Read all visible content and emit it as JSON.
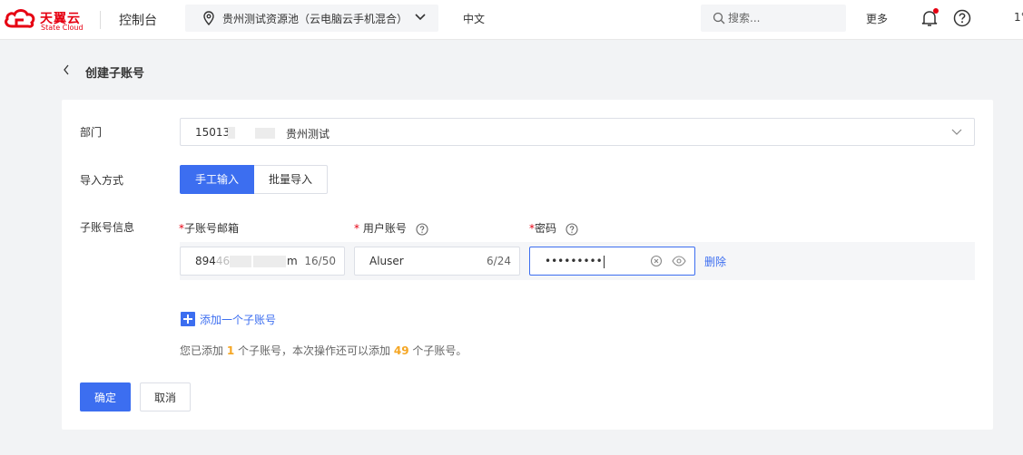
{
  "header": {
    "logo_cn": "天翼云",
    "logo_en": "State Cloud",
    "console": "控制台",
    "region": "贵州测试资源池（云电脑云手机混合）",
    "language": "中文",
    "search_placeholder": "搜索...",
    "more": "更多",
    "user": "1°"
  },
  "page": {
    "title": "创建子账号"
  },
  "form": {
    "department": {
      "label": "部门",
      "value_id": "15013",
      "value_name": "贵州测试"
    },
    "import_mode": {
      "label": "导入方式",
      "options": [
        "手工输入",
        "批量导入"
      ],
      "selected": "手工输入"
    },
    "subaccount": {
      "label": "子账号信息",
      "columns": {
        "email": "子账号邮箱",
        "username": "用户账号",
        "password": "密码"
      },
      "rows": [
        {
          "email_start": "894",
          "email_partial": "46",
          "email_end": "m",
          "email_count": "16/50",
          "username": "Aluser",
          "username_count": "6/24",
          "password_mask": "•••••••••",
          "delete": "删除"
        }
      ]
    },
    "add_button": "添加一个子账号",
    "info": {
      "prefix": "您已添加",
      "added": "1",
      "middle": "个子账号，本次操作还可以添加",
      "remaining": "49",
      "suffix": "个子账号。"
    },
    "confirm": "确定",
    "cancel": "取消"
  },
  "colors": {
    "primary": "#3c6ef0",
    "brand_red": "#e60012",
    "highlight_orange": "#f5a623"
  }
}
